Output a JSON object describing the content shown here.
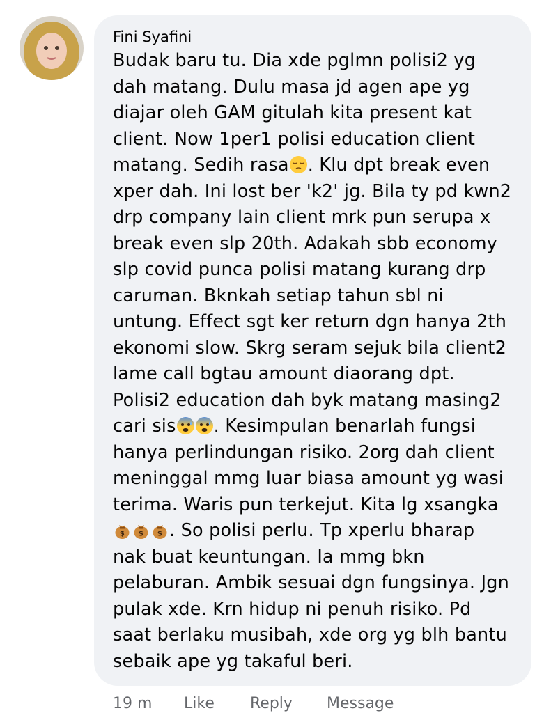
{
  "comment": {
    "author": "Fini Syafini",
    "lines": [
      "Budak baru tu. Dia xde pglmn polisi2 yg",
      "dah matang. Dulu masa jd agen ape yg",
      "diajar oleh GAM gitulah kita present kat",
      "client. Now 1per1 polisi education client",
      [
        "matang. Sedih rasa",
        "pensive-face-emoji",
        ". Klu dpt break even"
      ],
      "xper dah. Ini lost ber 'k2' jg. Bila ty pd kwn2",
      "drp company lain client mrk pun serupa x",
      "break even slp 20th. Adakah sbb economy",
      "slp covid punca polisi matang kurang drp",
      "caruman. Bknkah setiap tahun sbl ni",
      "untung. Effect sgt ker return dgn hanya 2th",
      "ekonomi slow. Skrg seram sejuk bila client2",
      "lame call bgtau amount diaorang dpt.",
      "Polisi2 education dah byk matang masing2",
      [
        "cari sis",
        "anxious-face-emoji",
        "anxious-face-emoji",
        ". Kesimpulan benarlah fungsi"
      ],
      "hanya perlindungan risiko. 2org dah client",
      "meninggal mmg luar biasa amount yg wasi",
      "terima. Waris pun terkejut. Kita lg xsangka",
      [
        "money-bag-emoji",
        "money-bag-emoji",
        "money-bag-emoji",
        ". So polisi perlu. Tp xperlu bharap"
      ],
      "nak buat keuntungan. Ia mmg bkn",
      "pelaburan. Ambik sesuai dgn fungsinya. Jgn",
      "pulak xde. Krn hidup ni penuh risiko. Pd",
      "saat berlaku musibah, xde org yg blh bantu",
      "sebaik ape yg takaful beri."
    ]
  },
  "actions": {
    "time": "19 m",
    "like": "Like",
    "reply": "Reply",
    "message": "Message"
  },
  "colors": {
    "bubble": "#f0f2f5",
    "text": "#050505",
    "secondary": "#65676b"
  }
}
